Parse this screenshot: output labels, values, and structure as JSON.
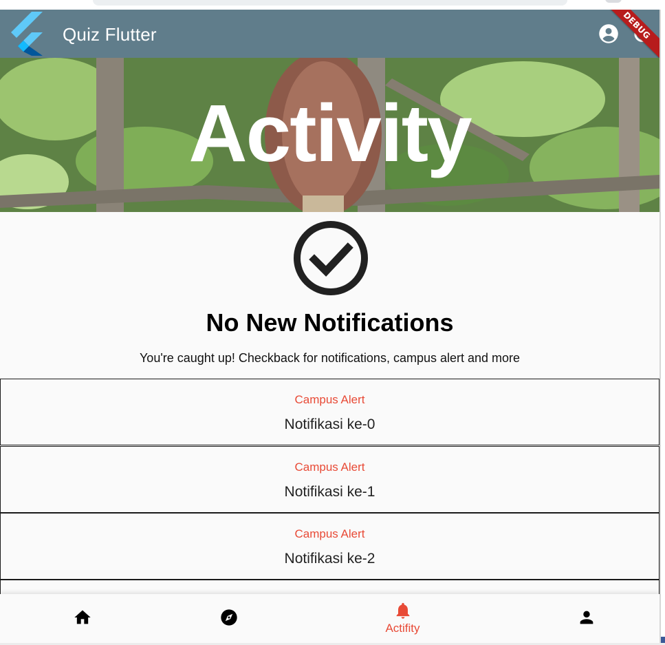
{
  "app": {
    "title": "Quiz Flutter",
    "debug_banner": "DEBUG"
  },
  "hero": {
    "title": "Activity"
  },
  "empty_state": {
    "icon": "check-circle-icon",
    "heading": "No New Notifications",
    "message": "You're caught up! Checkback for notifications, campus alert and more"
  },
  "notifications": [
    {
      "category": "Campus Alert",
      "text": "Notifikasi ke-0"
    },
    {
      "category": "Campus Alert",
      "text": "Notifikasi ke-1"
    },
    {
      "category": "Campus Alert",
      "text": "Notifikasi ke-2"
    }
  ],
  "bottom_nav": {
    "items": [
      {
        "icon": "home-icon",
        "label": ""
      },
      {
        "icon": "explore-icon",
        "label": ""
      },
      {
        "icon": "bell-icon",
        "label": "Actifity",
        "active": true
      },
      {
        "icon": "person-icon",
        "label": ""
      }
    ]
  },
  "colors": {
    "appbar": "#607d8b",
    "accent": "#e84a36",
    "background": "#fafafa",
    "debug": "#b71c1c"
  }
}
